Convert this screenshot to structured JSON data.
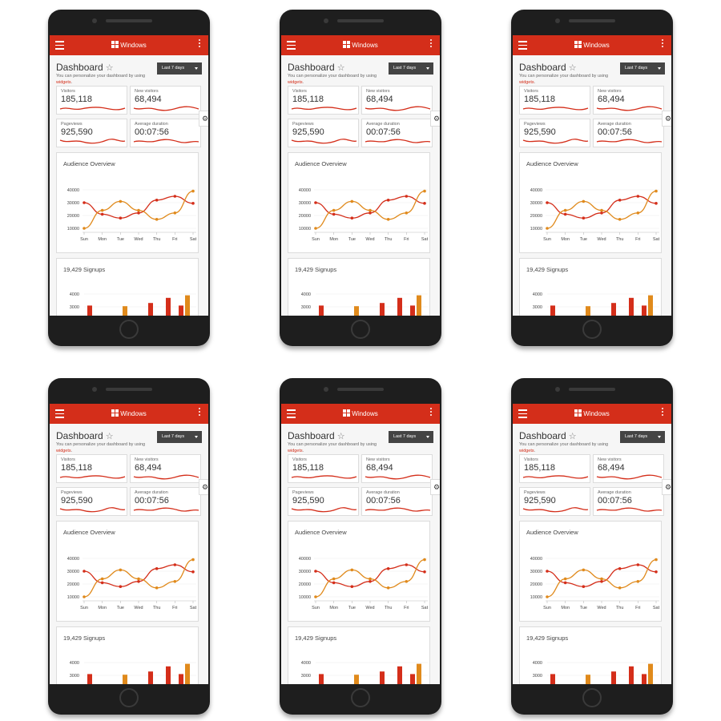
{
  "appbar": {
    "brand": "Windows",
    "icons": [
      "hamburger-menu-icon",
      "windows-logo-icon",
      "more-vert-icon"
    ]
  },
  "header": {
    "title": "Dashboard",
    "star": "☆",
    "subtitle_prefix": "You can personalize your dashboard by using ",
    "subtitle_link": "widgets",
    "subtitle_suffix": ".",
    "range_label": "Last 7 days"
  },
  "stats": [
    {
      "label": "Visitors",
      "value": "185,118"
    },
    {
      "label": "New visitors",
      "value": "68,494"
    },
    {
      "label": "Pageviews",
      "value": "925,590"
    },
    {
      "label": "Average duration",
      "value": "00:07:56"
    }
  ],
  "settings_icon": "gear-icon",
  "colors": {
    "accent": "#d42e1a",
    "orange": "#e08a1c",
    "red_series": "#d42e1a"
  },
  "audience": {
    "title": "Audience Overview"
  },
  "signups": {
    "title": "19,429 Signups"
  },
  "chart_data": [
    {
      "type": "line",
      "title": "Audience Overview",
      "categories": [
        "Sun",
        "Mon",
        "Tue",
        "Wed",
        "Thu",
        "Fri",
        "Sat"
      ],
      "yticks": [
        "40000",
        "30000",
        "20000",
        "10000"
      ],
      "ylim": [
        10000,
        40000
      ],
      "series": [
        {
          "color": "#d42e1a",
          "values": [
            30000,
            21000,
            18000,
            22000,
            32000,
            35000,
            29500
          ]
        },
        {
          "color": "#e08a1c",
          "values": [
            10000,
            24000,
            31000,
            24000,
            17000,
            22000,
            39000
          ]
        }
      ],
      "grid": true
    },
    {
      "type": "bar",
      "title": "19,429 Signups",
      "yticks": [
        "4000",
        "3000"
      ],
      "bars": [
        {
          "value": 3100,
          "color": "#d42e1a"
        },
        {
          "value": 3050,
          "color": "#e08a1c"
        },
        {
          "value": 3300,
          "color": "#d42e1a"
        },
        {
          "value": 3700,
          "color": "#d42e1a"
        },
        {
          "value": 3100,
          "color": "#d42e1a"
        },
        {
          "value": 3900,
          "color": "#e08a1c"
        }
      ]
    }
  ]
}
